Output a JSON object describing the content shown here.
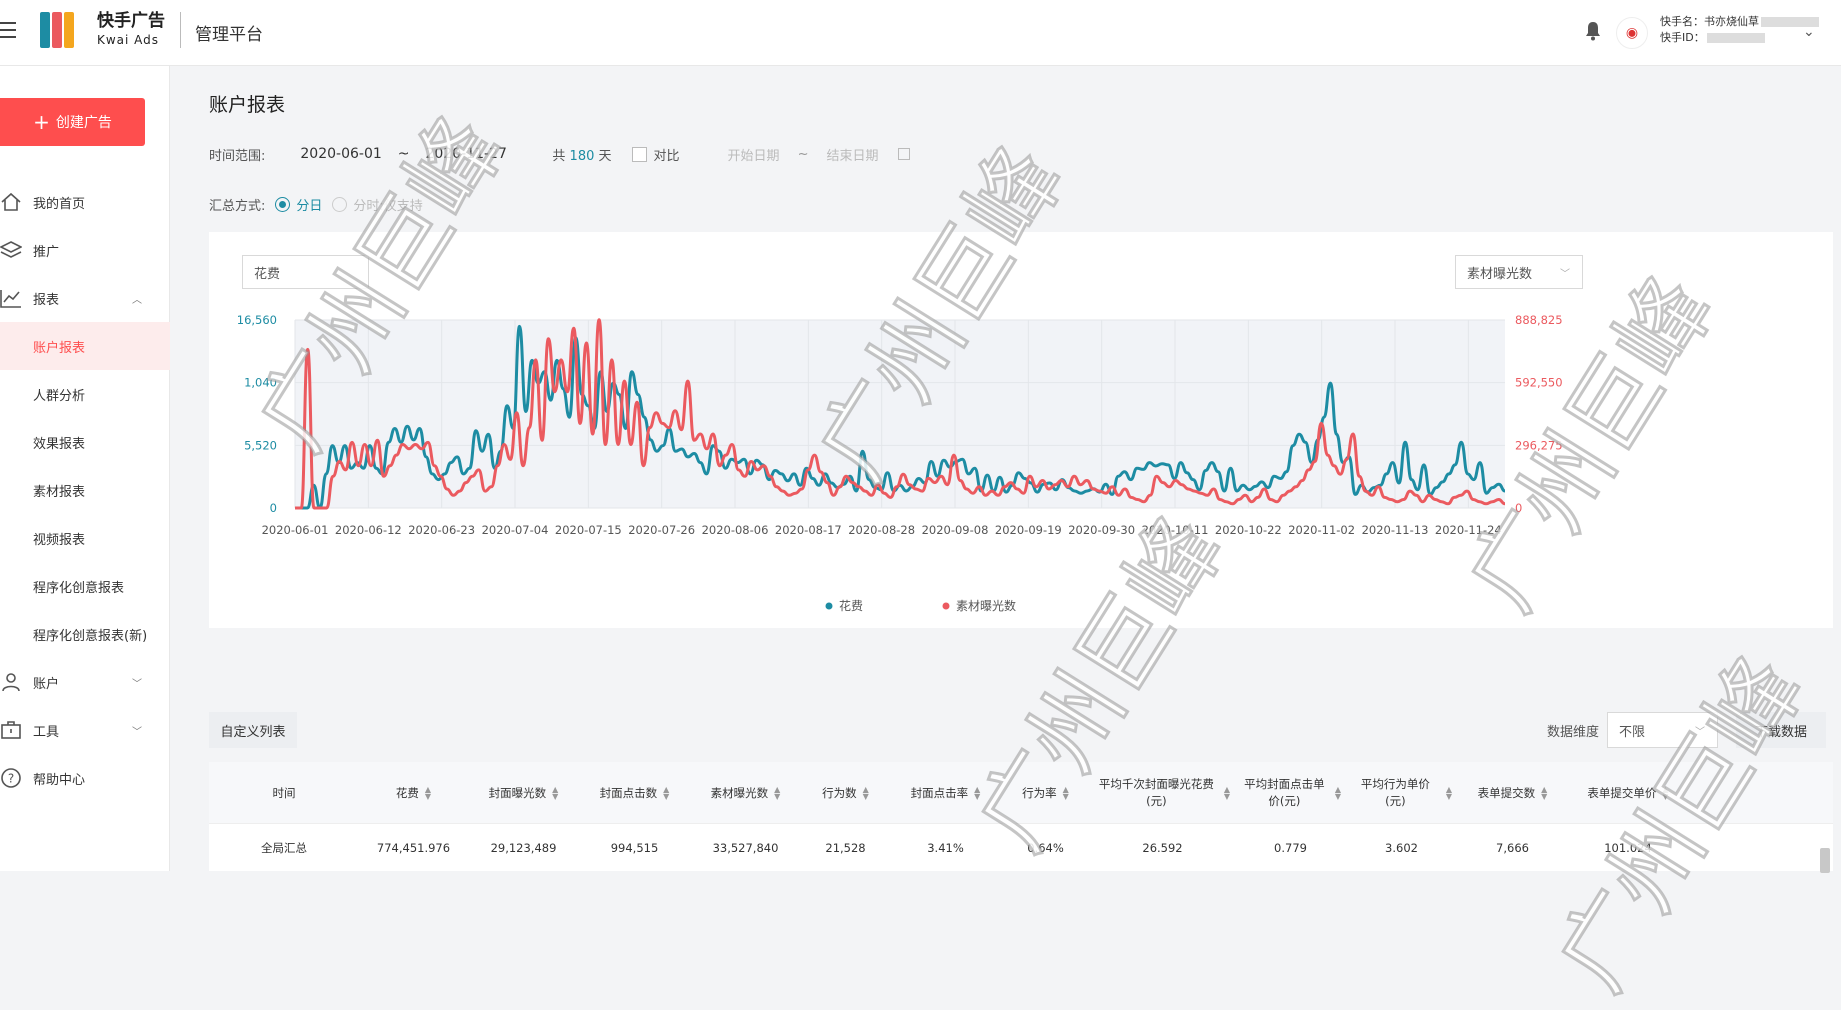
{
  "app": {
    "name_cn": "快手广告",
    "name_en": "Kwai Ads",
    "platform": "管理平台"
  },
  "user": {
    "name_label": "快手名：书亦烧仙草",
    "id_label": "快手ID："
  },
  "sidebar": {
    "create_button": "创建广告",
    "items": [
      {
        "label": "我的首页",
        "icon": "home-icon"
      },
      {
        "label": "推广",
        "icon": "layers-icon"
      },
      {
        "label": "报表",
        "icon": "chart-line-icon"
      },
      {
        "label": "账户报表"
      },
      {
        "label": "人群分析"
      },
      {
        "label": "效果报表"
      },
      {
        "label": "素材报表"
      },
      {
        "label": "视频报表"
      },
      {
        "label": "程序化创意报表"
      },
      {
        "label": "程序化创意报表(新)"
      },
      {
        "label": "账户",
        "icon": "user-icon"
      },
      {
        "label": "工具",
        "icon": "briefcase-icon"
      },
      {
        "label": "帮助中心",
        "icon": "help-circle-icon"
      }
    ]
  },
  "page": {
    "title": "账户报表",
    "time_range_label": "时间范围:",
    "start_date": "2020-06-01",
    "separator": "~",
    "end_date": "2020-11-27",
    "days_prefix": "共",
    "days_value": "180",
    "days_suffix": "天",
    "compare_label": "对比",
    "compare_start_placeholder": "开始日期",
    "compare_end_placeholder": "结束日期",
    "agg_label": "汇总方式:",
    "agg_daily": "分日",
    "agg_hourly": "分时:仅支持"
  },
  "chart_controls": {
    "left_metric": "花费",
    "right_metric": "素材曝光数"
  },
  "chart_data": {
    "type": "line",
    "x_ticks": [
      "2020-06-01",
      "2020-06-12",
      "2020-06-23",
      "2020-07-04",
      "2020-07-15",
      "2020-07-26",
      "2020-08-06",
      "2020-08-17",
      "2020-08-28",
      "2020-09-08",
      "2020-09-19",
      "2020-09-30",
      "2020-10-11",
      "2020-10-22",
      "2020-11-02",
      "2020-11-13",
      "2020-11-24"
    ],
    "y_left_ticks": [
      "0",
      "5,520",
      "1,040",
      "16,560"
    ],
    "y_right_ticks": [
      "0",
      "296,275",
      "592,550",
      "888,825"
    ],
    "ylim_left": [
      0,
      16560
    ],
    "ylim_right": [
      0,
      888825
    ],
    "grid": true,
    "legend": "bottom",
    "series": [
      {
        "name": "花费",
        "color": "#1d8ca3",
        "axis": "left",
        "values": [
          0,
          0,
          0,
          2000,
          0,
          3000,
          5500,
          4000,
          5500,
          3500,
          4000,
          3500,
          5500,
          3500,
          3000,
          5800,
          7000,
          5800,
          7200,
          6000,
          7000,
          4500,
          3000,
          2500,
          3000,
          4000,
          4500,
          3000,
          3500,
          6800,
          5000,
          6500,
          3500,
          5000,
          9000,
          7000,
          16000,
          8500,
          13000,
          11000,
          12000,
          9500,
          13000,
          10500,
          8000,
          15000,
          10000,
          9000,
          7000,
          12000,
          8500,
          11000,
          10000,
          7000,
          12000,
          10000,
          8000,
          6000,
          5000,
          5500,
          7000,
          5000,
          5200,
          4500,
          4800,
          4000,
          3000,
          5500,
          5000,
          3500,
          4300,
          4000,
          4300,
          3000,
          4200,
          3800,
          2500,
          3300,
          3000,
          2400,
          3000,
          2000,
          3500,
          2600,
          2000,
          3000,
          2200,
          1800,
          2100,
          2800,
          1500,
          5000,
          2500,
          1800,
          1600,
          3100,
          1500,
          2000,
          1500,
          1900,
          2600,
          2200,
          4100,
          2800,
          4200,
          3600,
          4100,
          4300,
          3000,
          3500,
          1500,
          2900,
          1500,
          2700,
          1400,
          2000,
          3100,
          2600,
          2200,
          1400,
          2100,
          2200,
          1600,
          2500,
          1800,
          1500,
          1300,
          1500,
          1700,
          1400,
          2100,
          1200,
          2800,
          3200,
          2500,
          3500,
          3400,
          4000,
          3700,
          3900,
          3800,
          2600,
          4000,
          3100,
          2500,
          1600,
          3300,
          4000,
          3200,
          1500,
          3500,
          1500,
          2000,
          1600,
          1900,
          2300,
          1800,
          2800,
          2600,
          3200,
          5500,
          6500,
          5800,
          4000,
          6000,
          8000,
          11000,
          6500,
          4000,
          4500,
          1200,
          2000,
          1400,
          1800,
          2000,
          3000,
          4000,
          2200,
          5800,
          2500,
          1600,
          3800,
          1200,
          1800,
          2300,
          3000,
          3800,
          5800,
          3000,
          2500,
          4000,
          1300,
          1800,
          2100,
          1500
        ]
      },
      {
        "name": "素材曝光数",
        "color": "#eb5a5f",
        "axis": "right",
        "values": [
          0,
          0,
          750000,
          0,
          0,
          0,
          150000,
          220000,
          180000,
          310000,
          200000,
          300000,
          200000,
          320000,
          150000,
          200000,
          250000,
          300000,
          280000,
          300000,
          280000,
          310000,
          200000,
          150000,
          90000,
          60000,
          80000,
          120000,
          150000,
          180000,
          80000,
          100000,
          200000,
          300000,
          230000,
          450000,
          200000,
          380000,
          700000,
          320000,
          800000,
          550000,
          700000,
          550000,
          850000,
          400000,
          780000,
          350000,
          890000,
          300000,
          700000,
          300000,
          600000,
          300000,
          500000,
          200000,
          380000,
          450000,
          400000,
          380000,
          460000,
          370000,
          600000,
          320000,
          350000,
          280000,
          350000,
          200000,
          250000,
          300000,
          180000,
          150000,
          220000,
          180000,
          200000,
          150000,
          100000,
          80000,
          60000,
          70000,
          90000,
          180000,
          250000,
          170000,
          120000,
          60000,
          100000,
          150000,
          120000,
          100000,
          80000,
          60000,
          110000,
          70000,
          50000,
          100000,
          160000,
          110000,
          90000,
          80000,
          140000,
          120000,
          150000,
          110000,
          250000,
          130000,
          90000,
          70000,
          100000,
          60000,
          80000,
          60000,
          100000,
          120000,
          90000,
          70000,
          150000,
          100000,
          130000,
          90000,
          110000,
          130000,
          100000,
          150000,
          110000,
          130000,
          90000,
          80000,
          70000,
          100000,
          60000,
          90000,
          50000,
          40000,
          30000,
          60000,
          150000,
          120000,
          100000,
          130000,
          110000,
          90000,
          80000,
          70000,
          60000,
          90000,
          40000,
          30000,
          20000,
          40000,
          60000,
          30000,
          50000,
          90000,
          40000,
          30000,
          60000,
          80000,
          100000,
          130000,
          180000,
          220000,
          400000,
          250000,
          200000,
          160000,
          230000,
          350000,
          150000,
          80000,
          60000,
          100000,
          50000,
          40000,
          30000,
          40000,
          80000,
          60000,
          30000,
          60000,
          40000,
          30000,
          20000,
          50000,
          60000,
          80000,
          40000,
          30000,
          20000,
          30000,
          40000,
          20000
        ]
      }
    ]
  },
  "table_bar": {
    "custom_columns": "自定义列表",
    "dimension_label": "数据维度",
    "dimension_value": "不限",
    "download": "下载数据"
  },
  "table": {
    "headers": [
      "时间",
      "花费",
      "封面曝光数",
      "封面点击数",
      "素材曝光数",
      "行为数",
      "封面点击率",
      "行为率",
      "平均千次封面曝光花费(元)",
      "平均封面点击单价(元)",
      "平均行为单价(元)",
      "表单提交数",
      "表单提交单价"
    ],
    "summary_row": [
      "全局汇总",
      "774,451.976",
      "29,123,489",
      "994,515",
      "33,527,840",
      "21,528",
      "3.41%",
      "0.64%",
      "26.592",
      "0.779",
      "3.602",
      "7,666",
      "101.024"
    ]
  },
  "watermark": "广州巨峰"
}
